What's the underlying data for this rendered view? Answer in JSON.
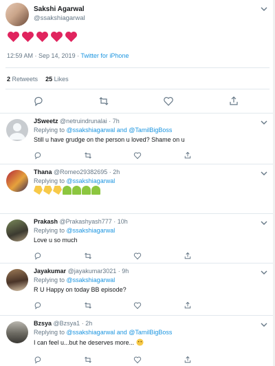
{
  "tweet": {
    "name": "Sakshi Agarwal",
    "handle": "@ssakshiagarwal",
    "hearts": [
      "red-heart",
      "red-heart",
      "red-heart",
      "red-heart",
      "red-heart"
    ],
    "time": "12:59 AM · Sep 14, 2019 · ",
    "source": "Twitter for iPhone",
    "retweets_count": "2",
    "retweets_label": "Retweets",
    "likes_count": "25",
    "likes_label": "Likes"
  },
  "replies": [
    {
      "name": "JSweetz",
      "handle": "@netruindrunalai",
      "time": "· 7h",
      "replying_prefix": "Replying to ",
      "mentions": "@ssakshiagarwal and @TamilBigBoss",
      "text": "Still u have grudge on the person u loved? Shame on u"
    },
    {
      "name": "Thana",
      "handle": "@Romeo29382695",
      "time": "· 2h",
      "replying_prefix": "Replying to ",
      "mentions": "@ssakshiagarwal",
      "text": "",
      "emoji": [
        "thumbs-down",
        "thumbs-down",
        "thumbs-down",
        "leaf",
        "leaf",
        "leaf",
        "leaf"
      ]
    },
    {
      "name": "Prakash",
      "handle": "@Prakashyash777",
      "time": "· 10h",
      "replying_prefix": "Replying to ",
      "mentions": "@ssakshiagarwal",
      "text": "Love u so much"
    },
    {
      "name": "Jayakumar",
      "handle": "@jayakumar3021",
      "time": "· 9h",
      "replying_prefix": "Replying to ",
      "mentions": "@ssakshiagarwal",
      "text": "R U Happy on today BB episode?"
    },
    {
      "name": "Bzsya",
      "handle": "@Bzsya1",
      "time": "· 2h",
      "replying_prefix": "Replying to ",
      "mentions": "@ssakshiagarwal and @TamilBigBoss",
      "text": "I can feel u...but he deserves more..."
    }
  ],
  "colors": {
    "accent": "#1b95e0",
    "heart": "#e0245e",
    "muted": "#657786"
  }
}
